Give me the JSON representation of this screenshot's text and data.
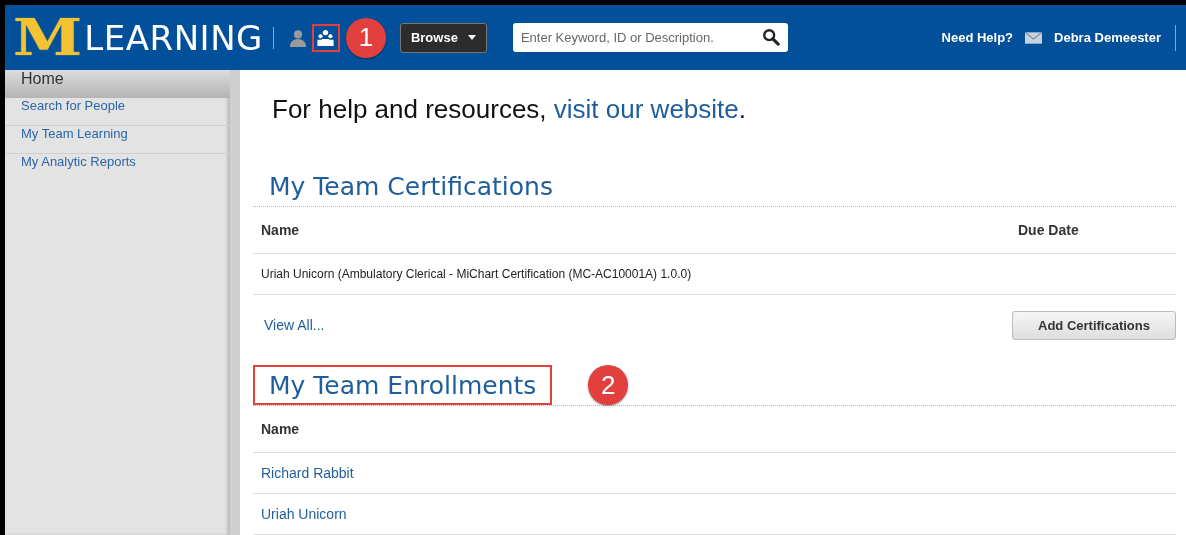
{
  "header": {
    "logo": {
      "letter": "M",
      "word": "LEARNING"
    },
    "icons": [
      {
        "kind": "person",
        "highlighted": false
      },
      {
        "kind": "team",
        "highlighted": true
      }
    ],
    "callout": "1",
    "browse": "Browse",
    "search": {
      "placeholder": "Enter Keyword, ID or Description."
    },
    "help": "Need Help?",
    "user": "Debra Demeester"
  },
  "sidebar": {
    "title": "Home",
    "items": [
      "Search for People",
      "My Team Learning",
      "My Analytic Reports"
    ]
  },
  "intro": {
    "text": "For help and resources, ",
    "link": "visit our website",
    "end": "."
  },
  "sections": [
    {
      "title": "My Team Certifications",
      "highlighted": false,
      "columns": [
        "Name",
        "Due Date"
      ],
      "rows": [
        [
          "Uriah Unicorn (Ambulatory Clerical - MiChart Certification (MC-AC10001A) 1.0.0)",
          ""
        ]
      ],
      "kind": "linkless",
      "view_all": "View All...",
      "button": "Add Certifications"
    },
    {
      "title": "My Team Enrollments",
      "highlighted": true,
      "callout": "2",
      "columns": [
        "Name"
      ],
      "rows": [
        [
          "Richard Rabbit"
        ],
        [
          "Uriah Unicorn"
        ]
      ],
      "kind": "links"
    }
  ]
}
